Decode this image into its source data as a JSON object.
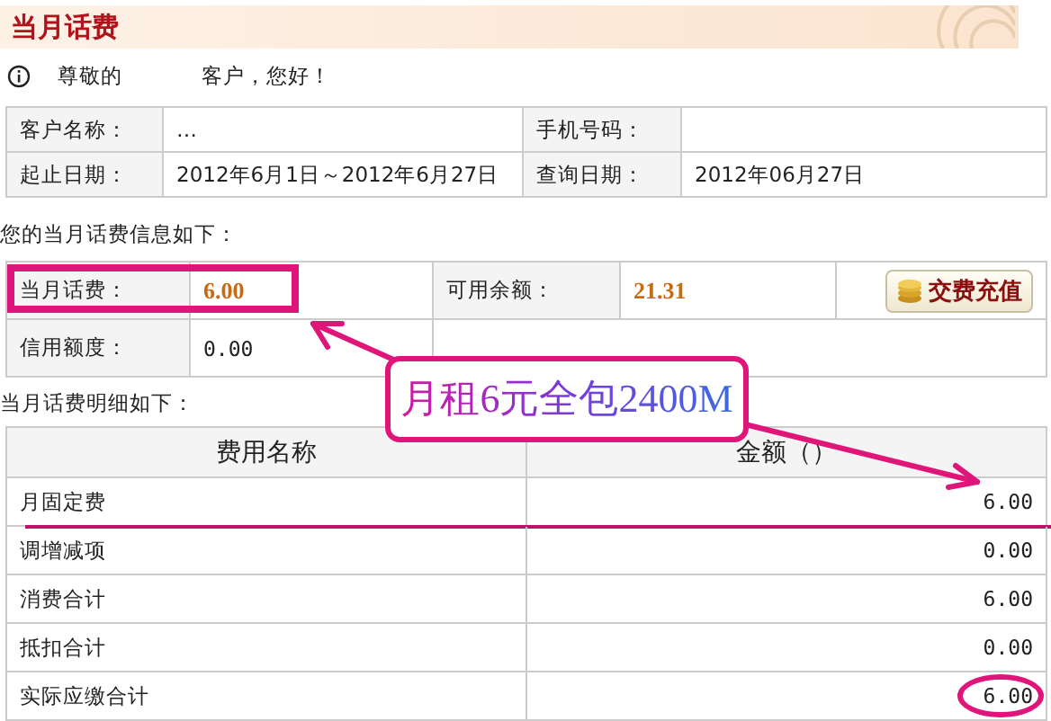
{
  "header": {
    "title": "当月话费"
  },
  "greeting": {
    "prefix": "尊敬的",
    "suffix": "客户，您好！"
  },
  "info_rows": [
    {
      "cells": [
        {
          "label": "客户名称：",
          "value": "…"
        },
        {
          "label": "手机号码："
        }
      ]
    },
    {
      "cells": [
        {
          "label": "起止日期：",
          "value": "2012年6月1日～2012年6月27日"
        },
        {
          "label": "查询日期：",
          "value": "2012年06月27日"
        }
      ]
    }
  ],
  "balance_intro": "您的当月话费信息如下：",
  "balance_rows": [
    {
      "cells": [
        {
          "label": "当月话费：",
          "value": "6.00",
          "kind": "amount",
          "circled": true
        },
        {
          "label": "可用余额：",
          "value": "21.31",
          "kind": "amount",
          "circled": false
        }
      ],
      "button": "交费充值"
    },
    {
      "cells": [
        {
          "label": "信用额度：",
          "value": "0.00",
          "kind": "plain",
          "circled": false
        }
      ]
    }
  ],
  "detail": {
    "intro": "当月话费明细如下：",
    "columns": [
      "费用名称",
      "金额（）"
    ],
    "rows": [
      {
        "name": "月固定费",
        "amount": "6.00",
        "underlined": true,
        "circled": false
      },
      {
        "name": "调增减项",
        "amount": "0.00",
        "underlined": false,
        "circled": false
      },
      {
        "name": "消费合计",
        "amount": "6.00",
        "underlined": false,
        "circled": false
      },
      {
        "name": "抵扣合计",
        "amount": "0.00",
        "underlined": false,
        "circled": false
      },
      {
        "name": "实际应缴合计",
        "amount": "6.00",
        "underlined": false,
        "circled": true
      }
    ]
  },
  "callout": {
    "text": "月租6元全包2400M"
  }
}
